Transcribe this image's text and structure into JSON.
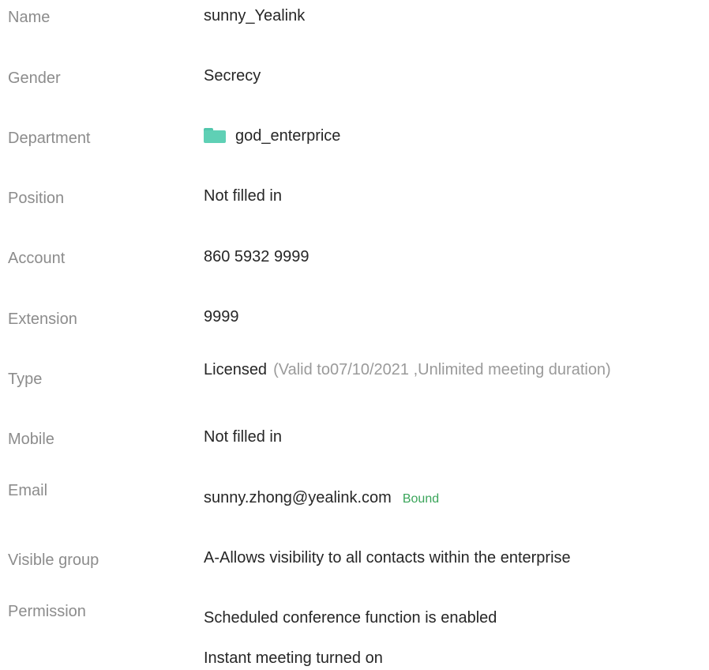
{
  "fields": {
    "name": {
      "label": "Name",
      "value": "sunny_Yealink"
    },
    "gender": {
      "label": "Gender",
      "value": "Secrecy"
    },
    "department": {
      "label": "Department",
      "value": "god_enterprice",
      "icon": "folder-icon",
      "icon_color": "#5fd0b5"
    },
    "position": {
      "label": "Position",
      "value": "Not filled in"
    },
    "account": {
      "label": "Account",
      "value": "860 5932 9999"
    },
    "extension": {
      "label": "Extension",
      "value": "9999"
    },
    "type": {
      "label": "Type",
      "value": "Licensed",
      "note": "(Valid to07/10/2021 ,Unlimited meeting duration)"
    },
    "mobile": {
      "label": "Mobile",
      "value": "Not filled in"
    },
    "email": {
      "label": "Email",
      "value": "sunny.zhong@yealink.com",
      "status": "Bound",
      "status_color": "#3aa55a"
    },
    "visible_group": {
      "label": "Visible group",
      "value": "A-Allows visibility to all contacts within the enterprise"
    },
    "permission": {
      "label": "Permission",
      "values": [
        "Scheduled conference function is enabled",
        "Instant meeting turned on"
      ]
    }
  }
}
